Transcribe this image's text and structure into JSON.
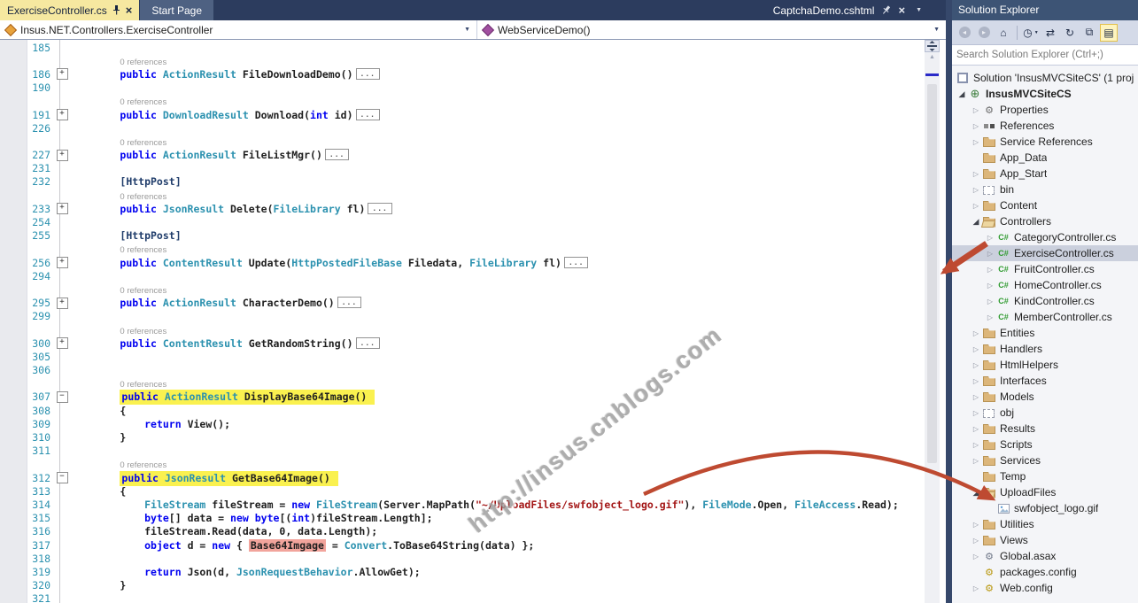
{
  "tab_bar": {
    "active_tab": "ExerciseController.cs",
    "tab2": "Start Page",
    "right_doc": "CaptchaDemo.cshtml"
  },
  "navbar": {
    "type_dropdown": "Insus.NET.Controllers.ExerciseController",
    "member_dropdown": "WebServiceDemo()"
  },
  "glyphs": {
    "close": "×",
    "caret_small": "▼",
    "scroll_up": "▲",
    "tree_collapsed": "▷",
    "tree_expanded": "◢",
    "csharp": "C#",
    "gear": "⚙",
    "globe": "⊕",
    "home": "⌂",
    "back": "◂",
    "forward": "▸",
    "pending": "◷",
    "sync": "⇄",
    "refresh": "↻",
    "collapse_all": "⧉",
    "show_all": "▤"
  },
  "colors": {
    "tabbar_bg": "#2C3C5E",
    "active_tab_bg": "#F6E8A0",
    "start_tab_bg": "#4E6182",
    "keyword": "#0000F0",
    "type": "#2B91AF",
    "string": "#A31515",
    "line_number": "#2B91AF",
    "yellow_highlight": "#FAF14F",
    "pink_highlight": "#F2A49C",
    "annotation_arrow": "#BE4A31",
    "se_title_bg": "#3D5475",
    "selected_row_bg": "#CBD0DD",
    "folder": "#DCB67A"
  },
  "watermark": {
    "text": "http://insus.cnblogs.com"
  },
  "editor": {
    "lines": [
      {
        "n": "185"
      },
      {
        "lens": "0 references",
        "ind": "        "
      },
      {
        "n": "186",
        "f": "+",
        "ind": "        ",
        "t": [
          [
            "public ",
            "k"
          ],
          [
            "ActionResult ",
            "t"
          ],
          [
            "FileDownloadDemo()",
            "p"
          ],
          [
            "...",
            "box"
          ]
        ]
      },
      {
        "n": "190"
      },
      {
        "lens": "0 references",
        "ind": "        "
      },
      {
        "n": "191",
        "f": "+",
        "ind": "        ",
        "t": [
          [
            "public ",
            "k"
          ],
          [
            "DownloadResult ",
            "t"
          ],
          [
            "Download(",
            "p"
          ],
          [
            "int",
            "k"
          ],
          [
            " id)",
            "p"
          ],
          [
            "...",
            "box"
          ]
        ]
      },
      {
        "n": "226"
      },
      {
        "lens": "0 references",
        "ind": "        "
      },
      {
        "n": "227",
        "f": "+",
        "ind": "        ",
        "t": [
          [
            "public ",
            "k"
          ],
          [
            "ActionResult ",
            "t"
          ],
          [
            "FileListMgr()",
            "p"
          ],
          [
            "...",
            "box"
          ]
        ]
      },
      {
        "n": "231"
      },
      {
        "n": "232",
        "ind": "        ",
        "t": [
          [
            "[HttpPost]",
            "a"
          ]
        ]
      },
      {
        "lens": "0 references",
        "ind": "        "
      },
      {
        "n": "233",
        "f": "+",
        "ind": "        ",
        "t": [
          [
            "public ",
            "k"
          ],
          [
            "JsonResult ",
            "t"
          ],
          [
            "Delete(",
            "p"
          ],
          [
            "FileLibrary",
            "t"
          ],
          [
            " fl)",
            "p"
          ],
          [
            "...",
            "box"
          ]
        ]
      },
      {
        "n": "254"
      },
      {
        "n": "255",
        "ind": "        ",
        "t": [
          [
            "[HttpPost]",
            "a"
          ]
        ]
      },
      {
        "lens": "0 references",
        "ind": "        "
      },
      {
        "n": "256",
        "f": "+",
        "ind": "        ",
        "t": [
          [
            "public ",
            "k"
          ],
          [
            "ContentResult ",
            "t"
          ],
          [
            "Update(",
            "p"
          ],
          [
            "HttpPostedFileBase",
            "t"
          ],
          [
            " Filedata, ",
            "p"
          ],
          [
            "FileLibrary",
            "t"
          ],
          [
            " fl)",
            "p"
          ],
          [
            "...",
            "box"
          ]
        ]
      },
      {
        "n": "294"
      },
      {
        "lens": "0 references",
        "ind": "        "
      },
      {
        "n": "295",
        "f": "+",
        "ind": "        ",
        "t": [
          [
            "public ",
            "k"
          ],
          [
            "ActionResult ",
            "t"
          ],
          [
            "CharacterDemo()",
            "p"
          ],
          [
            "...",
            "box"
          ]
        ]
      },
      {
        "n": "299"
      },
      {
        "lens": "0 references",
        "ind": "        "
      },
      {
        "n": "300",
        "f": "+",
        "ind": "        ",
        "t": [
          [
            "public ",
            "k"
          ],
          [
            "ContentResult ",
            "t"
          ],
          [
            "GetRandomString()",
            "p"
          ],
          [
            "...",
            "box"
          ]
        ]
      },
      {
        "n": "305"
      },
      {
        "n": "306"
      },
      {
        "lens": "0 references",
        "ind": "        "
      },
      {
        "n": "307",
        "f": "-",
        "hl": "y",
        "ind": "        ",
        "t": [
          [
            "public ",
            "k"
          ],
          [
            "ActionResult ",
            "t"
          ],
          [
            "DisplayBase64Image()",
            "p"
          ]
        ]
      },
      {
        "n": "308",
        "ind": "        ",
        "t": [
          [
            "{",
            "p"
          ]
        ]
      },
      {
        "n": "309",
        "ind": "            ",
        "t": [
          [
            "return ",
            "k"
          ],
          [
            "View();",
            "p"
          ]
        ]
      },
      {
        "n": "310",
        "ind": "        ",
        "t": [
          [
            "}",
            "p"
          ]
        ]
      },
      {
        "n": "311"
      },
      {
        "lens": "0 references",
        "ind": "        "
      },
      {
        "n": "312",
        "f": "-",
        "hl": "y",
        "ind": "        ",
        "t": [
          [
            "public ",
            "k"
          ],
          [
            "JsonResult ",
            "t"
          ],
          [
            "GetBase64Image()",
            "p"
          ]
        ]
      },
      {
        "n": "313",
        "ind": "        ",
        "t": [
          [
            "{",
            "p"
          ]
        ]
      },
      {
        "n": "314",
        "ind": "            ",
        "t": [
          [
            "FileStream",
            "t"
          ],
          [
            " fileStream = ",
            "p"
          ],
          [
            "new ",
            "k"
          ],
          [
            "FileStream",
            "t"
          ],
          [
            "(Server.MapPath(",
            "p"
          ],
          [
            "\"~/UploadFiles/swfobject_logo.gif\"",
            "s"
          ],
          [
            "), ",
            "p"
          ],
          [
            "FileMode",
            "t"
          ],
          [
            ".Open, ",
            "p"
          ],
          [
            "FileAccess",
            "t"
          ],
          [
            ".Read);",
            "p"
          ]
        ]
      },
      {
        "n": "315",
        "ind": "            ",
        "t": [
          [
            "byte",
            "k"
          ],
          [
            "[] data = ",
            "p"
          ],
          [
            "new ",
            "k"
          ],
          [
            "byte",
            "k"
          ],
          [
            "[(",
            "p"
          ],
          [
            "int",
            "k"
          ],
          [
            ")fileStream.Length];",
            "p"
          ]
        ]
      },
      {
        "n": "316",
        "ind": "            ",
        "t": [
          [
            "fileStream.Read(data, 0, data.Length);",
            "p"
          ]
        ]
      },
      {
        "n": "317",
        "ind": "            ",
        "t": [
          [
            "object",
            "k"
          ],
          [
            " d = ",
            "p"
          ],
          [
            "new ",
            "k"
          ],
          [
            "{ ",
            "p"
          ],
          [
            "Base64Imgage",
            "pink"
          ],
          [
            " = ",
            "p"
          ],
          [
            "Convert",
            "t"
          ],
          [
            ".ToBase64String(data) };",
            "p"
          ]
        ]
      },
      {
        "n": "318"
      },
      {
        "n": "319",
        "ind": "            ",
        "t": [
          [
            "return ",
            "k"
          ],
          [
            "Json(d, ",
            "p"
          ],
          [
            "JsonRequestBehavior",
            "t"
          ],
          [
            ".AllowGet);",
            "p"
          ]
        ]
      },
      {
        "n": "320",
        "ind": "        ",
        "t": [
          [
            "}",
            "p"
          ]
        ]
      },
      {
        "n": "321"
      }
    ]
  },
  "solution_explorer": {
    "title": "Solution Explorer",
    "search_placeholder": "Search Solution Explorer (Ctrl+;)",
    "toolbar": [
      {
        "name": "navigate-back-button",
        "glyph": "back",
        "circle": true,
        "disabled": true
      },
      {
        "name": "navigate-forward-button",
        "glyph": "forward",
        "circle": true,
        "disabled": true
      },
      {
        "name": "home-button",
        "glyph": "home"
      },
      {
        "sep": true
      },
      {
        "name": "pending-changes-filter-button",
        "glyph": "pending",
        "caret": true
      },
      {
        "name": "sync-with-active-document-button",
        "glyph": "sync"
      },
      {
        "name": "refresh-button",
        "glyph": "refresh"
      },
      {
        "name": "collapse-all-button",
        "glyph": "collapse_all"
      },
      {
        "name": "show-all-files-button",
        "glyph": "show_all",
        "active": true
      }
    ],
    "tree": [
      {
        "label": "Solution 'InsusMVCSiteCS' (1 proj",
        "icon": "solution",
        "level": 0,
        "arrow": "hidden"
      },
      {
        "label": "InsusMVCSiteCS",
        "icon": "project",
        "level": 0,
        "arrow": "exp",
        "bold": true
      },
      {
        "label": "Properties",
        "icon": "wrench",
        "level": 1,
        "arrow": "col"
      },
      {
        "label": "References",
        "icon": "references",
        "level": 1,
        "arrow": "col"
      },
      {
        "label": "Service References",
        "icon": "folder",
        "level": 1,
        "arrow": "col"
      },
      {
        "label": "App_Data",
        "icon": "folder",
        "level": 1,
        "arrow": "none"
      },
      {
        "label": "App_Start",
        "icon": "folder",
        "level": 1,
        "arrow": "col"
      },
      {
        "label": "bin",
        "icon": "folder-dashed",
        "level": 1,
        "arrow": "col"
      },
      {
        "label": "Content",
        "icon": "folder",
        "level": 1,
        "arrow": "col"
      },
      {
        "label": "Controllers",
        "icon": "folder-open",
        "level": 1,
        "arrow": "exp"
      },
      {
        "label": "CategoryController.cs",
        "icon": "csharp",
        "level": 2,
        "arrow": "col"
      },
      {
        "label": "ExerciseController.cs",
        "icon": "csharp",
        "level": 2,
        "arrow": "col",
        "selected": true
      },
      {
        "label": "FruitController.cs",
        "icon": "csharp",
        "level": 2,
        "arrow": "col"
      },
      {
        "label": "HomeController.cs",
        "icon": "csharp",
        "level": 2,
        "arrow": "col"
      },
      {
        "label": "KindController.cs",
        "icon": "csharp",
        "level": 2,
        "arrow": "col"
      },
      {
        "label": "MemberController.cs",
        "icon": "csharp",
        "level": 2,
        "arrow": "col"
      },
      {
        "label": "Entities",
        "icon": "folder",
        "level": 1,
        "arrow": "col"
      },
      {
        "label": "Handlers",
        "icon": "folder",
        "level": 1,
        "arrow": "col"
      },
      {
        "label": "HtmlHelpers",
        "icon": "folder",
        "level": 1,
        "arrow": "col"
      },
      {
        "label": "Interfaces",
        "icon": "folder",
        "level": 1,
        "arrow": "col"
      },
      {
        "label": "Models",
        "icon": "folder",
        "level": 1,
        "arrow": "col"
      },
      {
        "label": "obj",
        "icon": "folder-dashed",
        "level": 1,
        "arrow": "col"
      },
      {
        "label": "Results",
        "icon": "folder",
        "level": 1,
        "arrow": "col"
      },
      {
        "label": "Scripts",
        "icon": "folder",
        "level": 1,
        "arrow": "col"
      },
      {
        "label": "Services",
        "icon": "folder",
        "level": 1,
        "arrow": "col"
      },
      {
        "label": "Temp",
        "icon": "folder",
        "level": 1,
        "arrow": "none"
      },
      {
        "label": "UploadFiles",
        "icon": "folder-open",
        "level": 1,
        "arrow": "exp"
      },
      {
        "label": "swfobject_logo.gif",
        "icon": "image",
        "level": 2,
        "arrow": "none"
      },
      {
        "label": "Utilities",
        "icon": "folder",
        "level": 1,
        "arrow": "col"
      },
      {
        "label": "Views",
        "icon": "folder",
        "level": 1,
        "arrow": "col"
      },
      {
        "label": "Global.asax",
        "icon": "global",
        "level": 1,
        "arrow": "col"
      },
      {
        "label": "packages.config",
        "icon": "config",
        "level": 1,
        "arrow": "none"
      },
      {
        "label": "Web.config",
        "icon": "config",
        "level": 1,
        "arrow": "col"
      }
    ]
  }
}
